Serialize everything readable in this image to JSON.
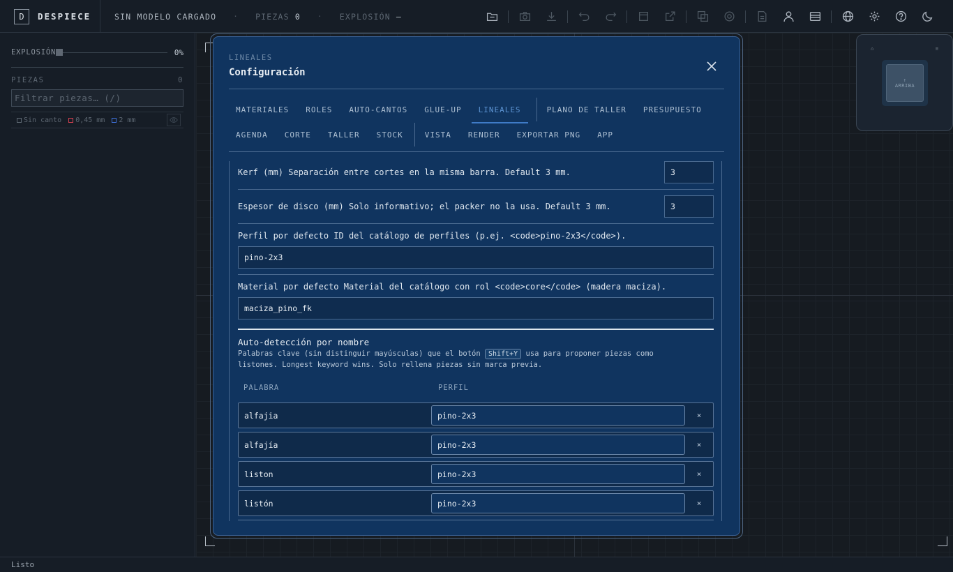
{
  "app": {
    "logo_letter": "D",
    "name": "DESPIECE",
    "model_status": "SIN MODELO CARGADO",
    "piezas_label": "PIEZAS",
    "piezas_count": "0",
    "explosion_label": "EXPLOSIÓN",
    "explosion_value": "—"
  },
  "toolbar": {
    "icons": [
      "folder-open-icon",
      "camera-icon",
      "download-icon",
      "undo-icon",
      "redo-icon",
      "sheet-icon",
      "export-icon",
      "layers-icon",
      "settings-cog-icon",
      "document-icon",
      "user-icon",
      "cards-icon",
      "globe-icon",
      "gear-icon",
      "help-icon",
      "moon-icon"
    ]
  },
  "sidebar": {
    "explosion_label": "EXPLOSIÓN",
    "explosion_percent": "0%",
    "explosion_level": 0,
    "piezas_label": "PIEZAS",
    "piezas_count": "0",
    "filter_placeholder": "Filtrar piezas… (/)",
    "legend": [
      {
        "label": "Sin canto",
        "color": "#5d6772"
      },
      {
        "label": "0,45 mm",
        "color": "#d04050"
      },
      {
        "label": "2 mm",
        "color": "#3d6fd6"
      }
    ]
  },
  "viewport": {
    "navcube_face": "ARRIBA",
    "navcube_arrow": "↑"
  },
  "statusbar": {
    "text": "Listo"
  },
  "modal": {
    "eyebrow": "LINEALES",
    "title": "Configuración",
    "tabs_row1": [
      {
        "label": "MATERIALES"
      },
      {
        "label": "ROLES"
      },
      {
        "label": "AUTO-CANTOS"
      },
      {
        "label": "GLUE-UP"
      },
      {
        "label": "LINEALES",
        "active": true
      },
      {
        "label": "PLANO DE TALLER"
      },
      {
        "label": "PRESUPUESTO"
      }
    ],
    "tabs_row2": [
      {
        "label": "AGENDA"
      },
      {
        "label": "CORTE"
      },
      {
        "label": "TALLER"
      },
      {
        "label": "STOCK"
      },
      {
        "label": "VISTA"
      },
      {
        "label": "RENDER"
      },
      {
        "label": "EXPORTAR PNG"
      },
      {
        "label": "APP"
      }
    ],
    "fields": {
      "kerf_label": "Kerf (mm) Separación entre cortes en la misma barra. Default 3 mm.",
      "kerf_value": "3",
      "disco_label": "Espesor de disco (mm) Solo informativo; el packer no la usa. Default 3 mm.",
      "disco_value": "3",
      "perfil_label": "Perfil por defecto ID del catálogo de perfiles (p.ej. <code>pino-2x3</code>).",
      "perfil_value": "pino-2x3",
      "material_label": "Material por defecto Material del catálogo con rol <code>core</code> (madera maciza).",
      "material_value": "maciza_pino_fk"
    },
    "autodetect": {
      "title": "Auto-detección por nombre",
      "desc_before": "Palabras clave (sin distinguir mayúsculas) que el botón ",
      "desc_kbd": "Shift+Y",
      "desc_after": " usa para proponer piezas como listones. Longest keyword wins. Solo rellena piezas sin marca previa.",
      "col_word": "PALABRA",
      "col_profile": "PERFIL",
      "delete_glyph": "×",
      "rows": [
        {
          "word": "alfajia",
          "profile": "pino-2x3"
        },
        {
          "word": "alfajía",
          "profile": "pino-2x3"
        },
        {
          "word": "liston",
          "profile": "pino-2x3"
        },
        {
          "word": "listón",
          "profile": "pino-2x3"
        }
      ]
    }
  }
}
